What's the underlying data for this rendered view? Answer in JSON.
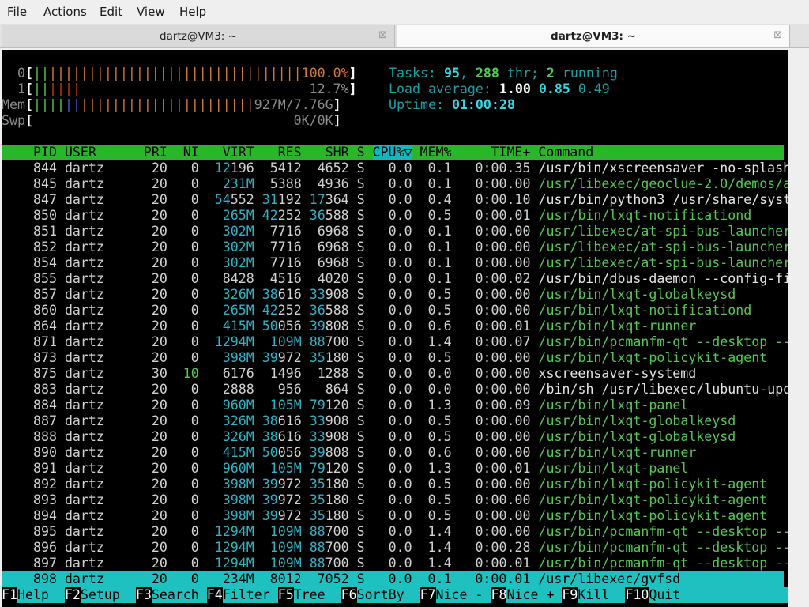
{
  "menubar": {
    "items": [
      "File",
      "Actions",
      "Edit",
      "View",
      "Help"
    ]
  },
  "tabs": [
    {
      "title": "dartz@VM3: ~",
      "close": "⊠",
      "active": false
    },
    {
      "title": "dartz@VM3: ~",
      "close": "⊠",
      "active": true
    }
  ],
  "meters": {
    "cpu0": {
      "label": "0",
      "value": "100.0%",
      "fraction": 1.0
    },
    "cpu1": {
      "label": "1",
      "value": "12.7%",
      "fraction": 0.127
    },
    "mem": {
      "label": "Mem",
      "value": "927M/7.76G"
    },
    "swp": {
      "label": "Swp",
      "value": "0K/0K"
    }
  },
  "summary": {
    "tasks_label": "Tasks:",
    "tasks": "95",
    "threads": "288",
    "thr_label": "thr;",
    "running": "2",
    "running_label": "running",
    "load_label": "Load average:",
    "load1": "1.00",
    "load5": "0.85",
    "load15": "0.49",
    "uptime_label": "Uptime:",
    "uptime": "01:00:28"
  },
  "table": {
    "columns": [
      "PID",
      "USER",
      "PRI",
      "NI",
      "VIRT",
      "RES",
      "SHR",
      "S",
      "CPU%▽",
      "MEM%",
      "TIME+",
      "Command"
    ],
    "sorted_column": "CPU%▽",
    "rows": [
      [
        "844",
        "dartz",
        "20",
        "0",
        "12196",
        "5412",
        "4652",
        "S",
        "0.0",
        "0.1",
        "0:00.35",
        "/usr/bin/xscreensaver -no-splash"
      ],
      [
        "845",
        "dartz",
        "20",
        "0",
        "231M",
        "5388",
        "4936",
        "S",
        "0.0",
        "0.1",
        "0:00.00",
        "/usr/libexec/geoclue-2.0/demos/age"
      ],
      [
        "847",
        "dartz",
        "20",
        "0",
        "54552",
        "31192",
        "17364",
        "S",
        "0.0",
        "0.4",
        "0:00.10",
        "/usr/bin/python3 /usr/share/system"
      ],
      [
        "850",
        "dartz",
        "20",
        "0",
        "265M",
        "42252",
        "36588",
        "S",
        "0.0",
        "0.5",
        "0:00.01",
        "/usr/bin/lxqt-notificationd"
      ],
      [
        "851",
        "dartz",
        "20",
        "0",
        "302M",
        "7716",
        "6968",
        "S",
        "0.0",
        "0.1",
        "0:00.00",
        "/usr/libexec/at-spi-bus-launcher -"
      ],
      [
        "852",
        "dartz",
        "20",
        "0",
        "302M",
        "7716",
        "6968",
        "S",
        "0.0",
        "0.1",
        "0:00.00",
        "/usr/libexec/at-spi-bus-launcher -"
      ],
      [
        "854",
        "dartz",
        "20",
        "0",
        "302M",
        "7716",
        "6968",
        "S",
        "0.0",
        "0.1",
        "0:00.00",
        "/usr/libexec/at-spi-bus-launcher -"
      ],
      [
        "855",
        "dartz",
        "20",
        "0",
        "8428",
        "4516",
        "4020",
        "S",
        "0.0",
        "0.1",
        "0:00.02",
        "/usr/bin/dbus-daemon --config-file"
      ],
      [
        "857",
        "dartz",
        "20",
        "0",
        "326M",
        "38616",
        "33908",
        "S",
        "0.0",
        "0.5",
        "0:00.00",
        "/usr/bin/lxqt-globalkeysd"
      ],
      [
        "860",
        "dartz",
        "20",
        "0",
        "265M",
        "42252",
        "36588",
        "S",
        "0.0",
        "0.5",
        "0:00.00",
        "/usr/bin/lxqt-notificationd"
      ],
      [
        "864",
        "dartz",
        "20",
        "0",
        "415M",
        "50056",
        "39808",
        "S",
        "0.0",
        "0.6",
        "0:00.01",
        "/usr/bin/lxqt-runner"
      ],
      [
        "871",
        "dartz",
        "20",
        "0",
        "1294M",
        "109M",
        "88700",
        "S",
        "0.0",
        "1.4",
        "0:00.07",
        "/usr/bin/pcmanfm-qt --desktop --pr"
      ],
      [
        "873",
        "dartz",
        "20",
        "0",
        "398M",
        "39972",
        "35180",
        "S",
        "0.0",
        "0.5",
        "0:00.00",
        "/usr/bin/lxqt-policykit-agent"
      ],
      [
        "875",
        "dartz",
        "30",
        "10",
        "6176",
        "1496",
        "1288",
        "S",
        "0.0",
        "0.0",
        "0:00.00",
        "xscreensaver-systemd"
      ],
      [
        "883",
        "dartz",
        "20",
        "0",
        "2888",
        "956",
        "864",
        "S",
        "0.0",
        "0.0",
        "0:00.00",
        "/bin/sh /usr/libexec/lubuntu-updat"
      ],
      [
        "884",
        "dartz",
        "20",
        "0",
        "960M",
        "105M",
        "79120",
        "S",
        "0.0",
        "1.3",
        "0:00.09",
        "/usr/bin/lxqt-panel"
      ],
      [
        "887",
        "dartz",
        "20",
        "0",
        "326M",
        "38616",
        "33908",
        "S",
        "0.0",
        "0.5",
        "0:00.00",
        "/usr/bin/lxqt-globalkeysd"
      ],
      [
        "888",
        "dartz",
        "20",
        "0",
        "326M",
        "38616",
        "33908",
        "S",
        "0.0",
        "0.5",
        "0:00.00",
        "/usr/bin/lxqt-globalkeysd"
      ],
      [
        "890",
        "dartz",
        "20",
        "0",
        "415M",
        "50056",
        "39808",
        "S",
        "0.0",
        "0.6",
        "0:00.00",
        "/usr/bin/lxqt-runner"
      ],
      [
        "891",
        "dartz",
        "20",
        "0",
        "960M",
        "105M",
        "79120",
        "S",
        "0.0",
        "1.3",
        "0:00.01",
        "/usr/bin/lxqt-panel"
      ],
      [
        "892",
        "dartz",
        "20",
        "0",
        "398M",
        "39972",
        "35180",
        "S",
        "0.0",
        "0.5",
        "0:00.00",
        "/usr/bin/lxqt-policykit-agent"
      ],
      [
        "893",
        "dartz",
        "20",
        "0",
        "398M",
        "39972",
        "35180",
        "S",
        "0.0",
        "0.5",
        "0:00.00",
        "/usr/bin/lxqt-policykit-agent"
      ],
      [
        "894",
        "dartz",
        "20",
        "0",
        "398M",
        "39972",
        "35180",
        "S",
        "0.0",
        "0.5",
        "0:00.00",
        "/usr/bin/lxqt-policykit-agent"
      ],
      [
        "895",
        "dartz",
        "20",
        "0",
        "1294M",
        "109M",
        "88700",
        "S",
        "0.0",
        "1.4",
        "0:00.00",
        "/usr/bin/pcmanfm-qt --desktop --pr"
      ],
      [
        "896",
        "dartz",
        "20",
        "0",
        "1294M",
        "109M",
        "88700",
        "S",
        "0.0",
        "1.4",
        "0:00.28",
        "/usr/bin/pcmanfm-qt --desktop --pr"
      ],
      [
        "897",
        "dartz",
        "20",
        "0",
        "1294M",
        "109M",
        "88700",
        "S",
        "0.0",
        "1.4",
        "0:00.01",
        "/usr/bin/pcmanfm-qt --desktop --pr"
      ],
      [
        "898",
        "dartz",
        "20",
        "0",
        "234M",
        "8012",
        "7052",
        "S",
        "0.0",
        "0.1",
        "0:00.01",
        "/usr/libexec/gvfsd"
      ]
    ],
    "selected_row": 26
  },
  "function_keys": [
    {
      "key": "F1",
      "label": "Help"
    },
    {
      "key": "F2",
      "label": "Setup"
    },
    {
      "key": "F3",
      "label": "Search"
    },
    {
      "key": "F4",
      "label": "Filter"
    },
    {
      "key": "F5",
      "label": "Tree"
    },
    {
      "key": "F6",
      "label": "SortBy"
    },
    {
      "key": "F7",
      "label": "Nice -"
    },
    {
      "key": "F8",
      "label": "Nice +"
    },
    {
      "key": "F9",
      "label": "Kill"
    },
    {
      "key": "F10",
      "label": "Quit"
    }
  ],
  "colors": {
    "terminal_bg": "#000000",
    "header_bg": "#2ab52a",
    "sort_column_bg": "#0fb8c0",
    "selected_row_bg": "#1ec0c0",
    "command_green": "#55c753",
    "highlight_cyan": "#2fb2c4"
  }
}
